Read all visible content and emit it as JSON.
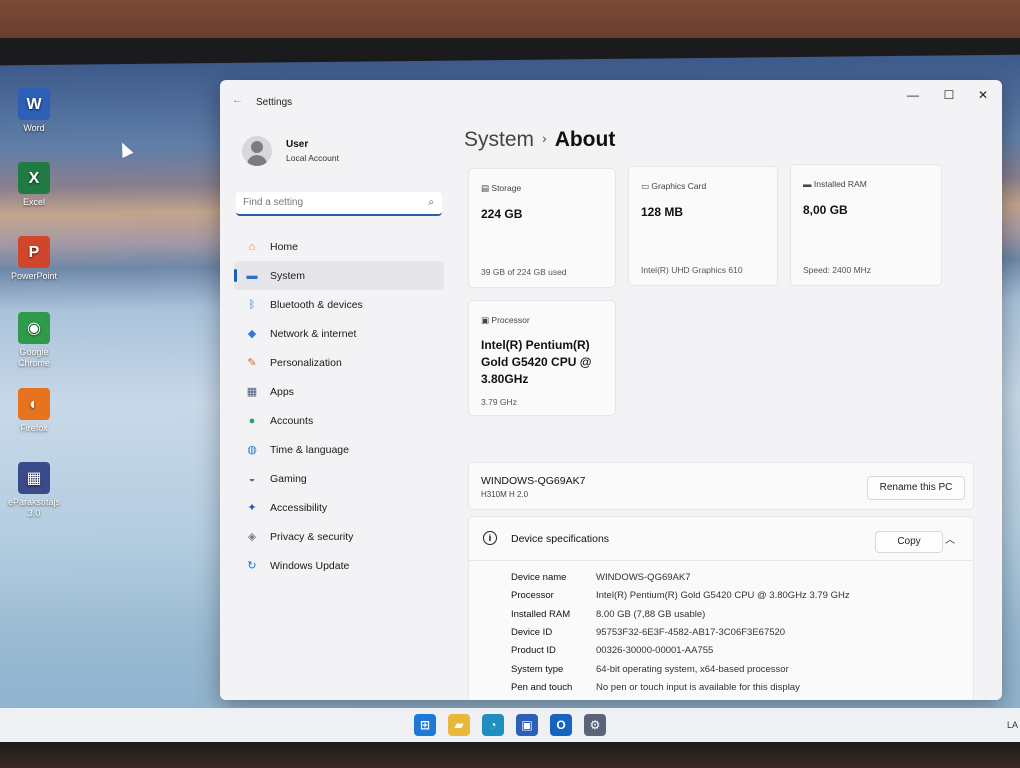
{
  "desktop": {
    "icons": [
      {
        "label": "Word",
        "glyph": "W",
        "color": "#2b5fb8"
      },
      {
        "label": "Excel",
        "glyph": "X",
        "color": "#1f7a44"
      },
      {
        "label": "PowerPoint",
        "glyph": "P",
        "color": "#d0462a"
      },
      {
        "label": "Google Chrome",
        "glyph": "◉",
        "color": "#2f9b4a"
      },
      {
        "label": "Firefox",
        "glyph": "◐",
        "color": "#e8731f"
      },
      {
        "label": "eParakstītājs 3.0",
        "glyph": "▦",
        "color": "#3b4b8a"
      }
    ]
  },
  "window": {
    "app_title": "Settings",
    "back": "←",
    "controls": {
      "minimize": "—",
      "maximize": "☐",
      "close": "✕"
    }
  },
  "user": {
    "name": "User",
    "account_type": "Local Account"
  },
  "search": {
    "placeholder": "Find a setting",
    "icon": "⌕"
  },
  "nav": [
    {
      "label": "Home",
      "icon": "home-icon",
      "glyph": "⌂",
      "color": "#e07a2e",
      "active": false
    },
    {
      "label": "System",
      "icon": "system-icon",
      "glyph": "▬",
      "color": "#2a6fc0",
      "active": true
    },
    {
      "label": "Bluetooth & devices",
      "icon": "bluetooth-icon",
      "glyph": "ᛒ",
      "color": "#1e73d6",
      "active": false
    },
    {
      "label": "Network & internet",
      "icon": "wifi-icon",
      "glyph": "◆",
      "color": "#2f7bd6",
      "active": false
    },
    {
      "label": "Personalization",
      "icon": "brush-icon",
      "glyph": "✎",
      "color": "#d26a2a",
      "active": false
    },
    {
      "label": "Apps",
      "icon": "apps-icon",
      "glyph": "▦",
      "color": "#4a5a7a",
      "active": false
    },
    {
      "label": "Accounts",
      "icon": "accounts-icon",
      "glyph": "●",
      "color": "#2aa36a",
      "active": false
    },
    {
      "label": "Time & language",
      "icon": "globe-icon",
      "glyph": "◍",
      "color": "#2a7ac8",
      "active": false
    },
    {
      "label": "Gaming",
      "icon": "gamepad-icon",
      "glyph": "◒",
      "color": "#6a6a76",
      "active": false
    },
    {
      "label": "Accessibility",
      "icon": "accessibility-icon",
      "glyph": "✦",
      "color": "#1d5fb0",
      "active": false
    },
    {
      "label": "Privacy & security",
      "icon": "shield-icon",
      "glyph": "◈",
      "color": "#7a7a84",
      "active": false
    },
    {
      "label": "Windows Update",
      "icon": "update-icon",
      "glyph": "↻",
      "color": "#1e73d6",
      "active": false
    }
  ],
  "breadcrumb": {
    "parent": "System",
    "separator": "›",
    "current": "About"
  },
  "cards": {
    "storage": {
      "label": "Storage",
      "value": "224 GB",
      "sub": "39 GB of 224 GB used"
    },
    "graphics": {
      "label": "Graphics Card",
      "value": "128 MB",
      "sub": "Intel(R) UHD Graphics 610"
    },
    "ram": {
      "label": "Installed RAM",
      "value": "8,00 GB",
      "sub": "Speed: 2400 MHz"
    },
    "processor": {
      "label": "Processor",
      "value": "Intel(R) Pentium(R) Gold G5420 CPU @ 3.80GHz",
      "sub": "3.79 GHz"
    }
  },
  "pc": {
    "name": "WINDOWS-QG69AK7",
    "model": "H310M H 2.0",
    "rename_label": "Rename this PC"
  },
  "specs": {
    "title": "Device specifications",
    "copy_label": "Copy",
    "rows": [
      {
        "k": "Device name",
        "v": "WINDOWS-QG69AK7"
      },
      {
        "k": "Processor",
        "v": "Intel(R) Pentium(R) Gold G5420 CPU @ 3.80GHz   3.79 GHz"
      },
      {
        "k": "Installed RAM",
        "v": "8.00 GB (7,88 GB usable)"
      },
      {
        "k": "Device ID",
        "v": "95753F32-6E3F-4582-AB17-3C06F3E67520"
      },
      {
        "k": "Product ID",
        "v": "00326-30000-00001-AA755"
      },
      {
        "k": "System type",
        "v": "64-bit operating system, x64-based processor"
      },
      {
        "k": "Pen and touch",
        "v": "No pen or touch input is available for this display"
      }
    ]
  },
  "taskbar": {
    "items": [
      {
        "name": "start-icon",
        "glyph": "⊞",
        "color": "#1e78d7"
      },
      {
        "name": "file-explorer-icon",
        "glyph": "▰",
        "color": "#e8b83a"
      },
      {
        "name": "edge-icon",
        "glyph": "◔",
        "color": "#1f8fbf"
      },
      {
        "name": "store-icon",
        "glyph": "▣",
        "color": "#2b5fb8"
      },
      {
        "name": "outlook-icon",
        "glyph": "O",
        "color": "#1565c0"
      },
      {
        "name": "settings-icon",
        "glyph": "⚙",
        "color": "#5a6478"
      }
    ],
    "right_text": "LA"
  }
}
